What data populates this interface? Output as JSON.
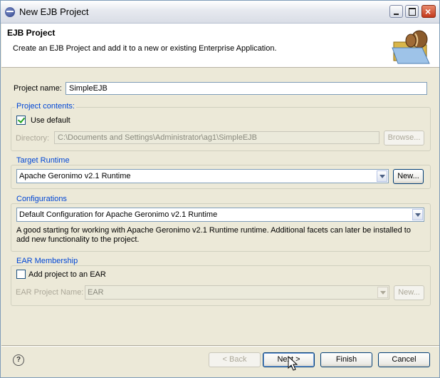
{
  "window": {
    "title": "New EJB Project"
  },
  "banner": {
    "heading": "EJB Project",
    "description": "Create an EJB Project and add it to a new or existing Enterprise Application."
  },
  "project_name": {
    "label": "Project name:",
    "value": "SimpleEJB"
  },
  "project_contents": {
    "title": "Project contents:",
    "use_default_label": "Use default",
    "use_default_checked": true,
    "directory_label": "Directory:",
    "directory_value": "C:\\Documents and Settings\\Administrator\\ag1\\SimpleEJB",
    "browse_label": "Browse..."
  },
  "target_runtime": {
    "title": "Target Runtime",
    "selected": "Apache Geronimo v2.1 Runtime",
    "new_label": "New..."
  },
  "configurations": {
    "title": "Configurations",
    "selected": "Default Configuration for Apache Geronimo v2.1 Runtime",
    "description": "A good starting for working with Apache Geronimo v2.1 Runtime runtime. Additional facets can later be installed to add new functionality to the project."
  },
  "ear_membership": {
    "title": "EAR Membership",
    "add_label": "Add project to an EAR",
    "add_checked": false,
    "ear_name_label": "EAR Project Name:",
    "ear_name_value": "EAR",
    "new_label": "New..."
  },
  "footer": {
    "help": "?",
    "back_label": "< Back",
    "next_label": "Next >",
    "finish_label": "Finish",
    "cancel_label": "Cancel"
  }
}
